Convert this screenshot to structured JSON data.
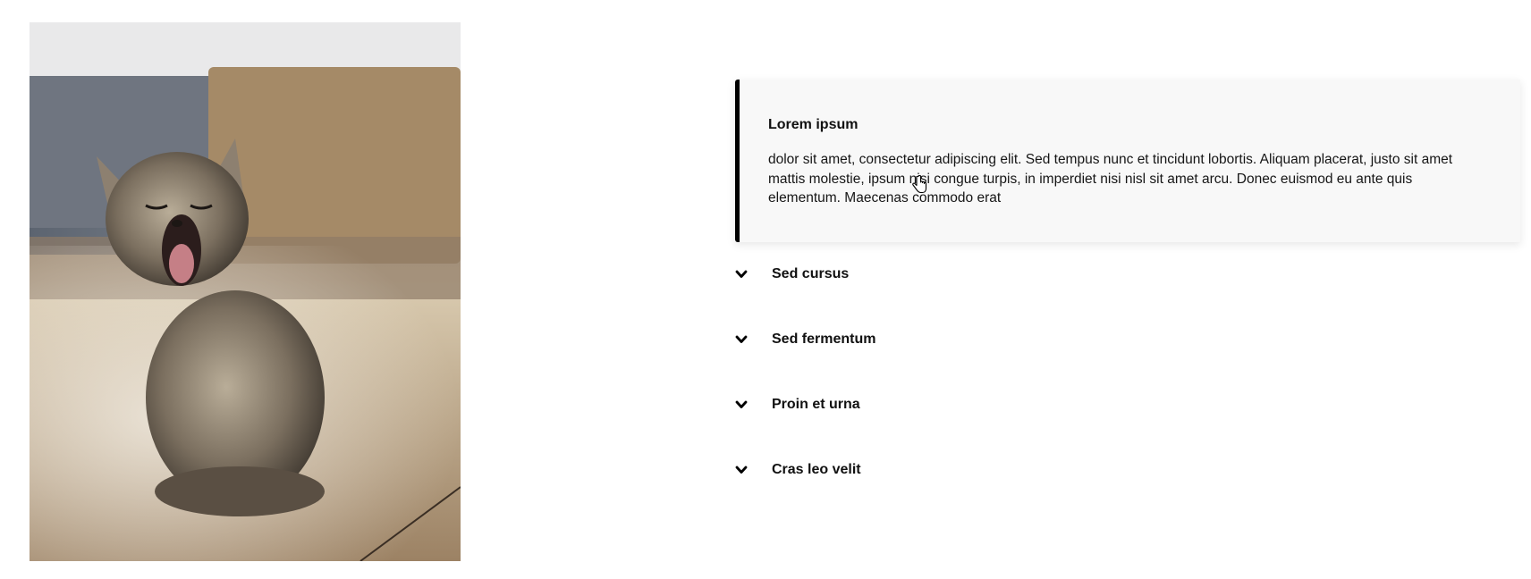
{
  "image": {
    "alt": "kitten yawning",
    "icon": "photo-kitten"
  },
  "accordion": {
    "open_item": {
      "title": "Lorem ipsum",
      "body": "dolor sit amet, consectetur adipiscing elit. Sed tempus nunc et tincidunt lobortis. Aliquam placerat, justo sit amet mattis molestie, ipsum nisi congue turpis, in imperdiet nisi nisl sit amet arcu. Donec euismod eu ante quis elementum. Maecenas commodo erat"
    },
    "items": [
      {
        "label": "Sed cursus",
        "icon": "chevron-down-icon"
      },
      {
        "label": "Sed fermentum",
        "icon": "chevron-down-icon"
      },
      {
        "label": "Proin et urna",
        "icon": "chevron-down-icon"
      },
      {
        "label": "Cras leo velit",
        "icon": "chevron-down-icon"
      }
    ]
  },
  "colors": {
    "accent_border": "#000000",
    "panel_background": "#f8f8f8"
  }
}
